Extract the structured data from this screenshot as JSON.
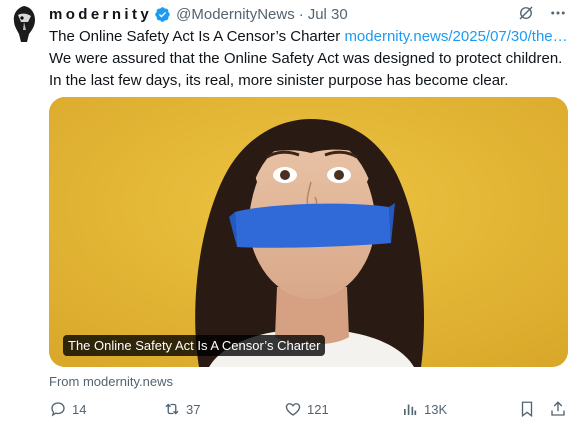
{
  "tweet": {
    "author_name": "modernity",
    "handle": "@ModernityNews",
    "separator": "·",
    "date": "Jul 30",
    "text_line1_prefix": "The Online Safety Act Is A Censor’s Charter ",
    "text_line1_link": "modernity.news/2025/07/30/the…",
    "text_line2": "We were assured that the Online Safety Act was designed to protect children.",
    "text_line3": "In the last few days, its real, more sinister purpose has become clear."
  },
  "card": {
    "caption": "The Online Safety Act Is A Censor’s Charter",
    "source": "From modernity.news",
    "image_description_icon": "photo"
  },
  "actions": {
    "replies": "14",
    "reposts": "37",
    "likes": "121",
    "views": "13K"
  },
  "icons": {
    "verified": "verified-badge-icon",
    "grok": "grok-icon",
    "more": "more-icon",
    "reply": "reply-icon",
    "repost": "repost-icon",
    "like": "heart-icon",
    "views": "views-icon",
    "bookmark": "bookmark-icon",
    "share": "share-icon"
  },
  "colors": {
    "link": "#1d9bf0",
    "verified": "#1d9bf0",
    "secondary_text": "#536471",
    "card_background": "#e3b536"
  }
}
